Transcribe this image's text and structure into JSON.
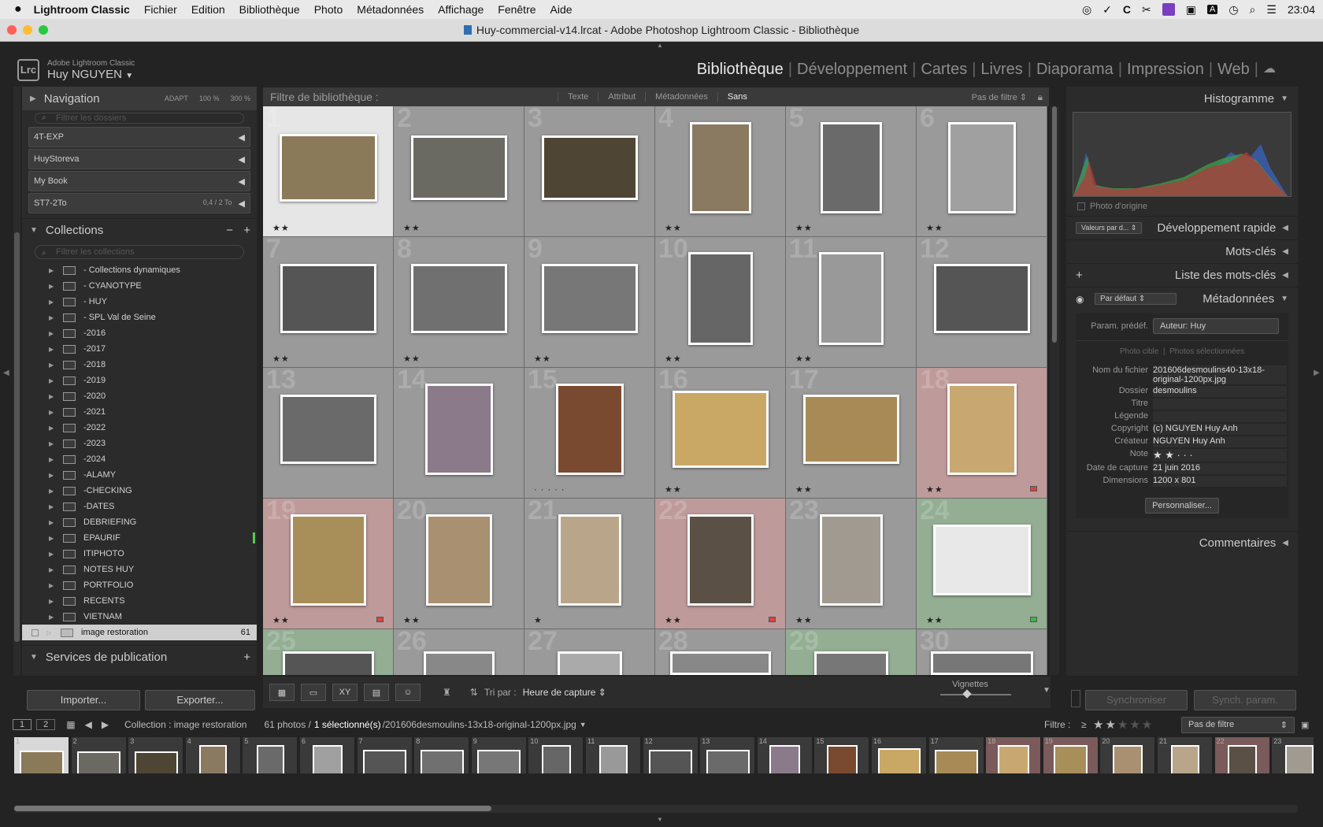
{
  "menubar": {
    "app_name": "Lightroom Classic",
    "items": [
      "Fichier",
      "Edition",
      "Bibliothèque",
      "Photo",
      "Métadonnées",
      "Affichage",
      "Fenêtre",
      "Aide"
    ],
    "clock": "23:04",
    "status_a": "A"
  },
  "window": {
    "title": "Huy-commercial-v14.lrcat - Adobe Photoshop Lightroom Classic - Bibliothèque"
  },
  "identity": {
    "brand": "Adobe Lightroom Classic",
    "user": "Huy NGUYEN",
    "logo": "Lrc"
  },
  "modules": {
    "items": [
      "Bibliothèque",
      "Développement",
      "Cartes",
      "Livres",
      "Diaporama",
      "Impression",
      "Web"
    ],
    "active": "Bibliothèque"
  },
  "left": {
    "navigation": {
      "title": "Navigation",
      "adapt": "ADAPT",
      "z100": "100 %",
      "z300": "300 %"
    },
    "folders_search": "Filtrer les dossiers",
    "volumes": [
      {
        "name": "4T-EXP",
        "info": ""
      },
      {
        "name": "HuyStoreva",
        "info": ""
      },
      {
        "name": "My Book",
        "info": ""
      },
      {
        "name": "ST7-2To",
        "info": "0,4 / 2 To"
      }
    ],
    "collections": {
      "title": "Collections",
      "search": "Filtrer les collections",
      "items": [
        "- Collections dynamiques",
        "- CYANOTYPE",
        "- HUY",
        "- SPL Val de Seine",
        "-2016",
        "-2017",
        "-2018",
        "-2019",
        "-2020",
        "-2021",
        "-2022",
        "-2023",
        "-2024",
        "-ALAMY",
        "-CHECKING",
        "-DATES",
        "DEBRIEFING",
        "EPAURIF",
        "ITIPHOTO",
        "NOTES HUY",
        "PORTFOLIO",
        "RECENTS",
        "VIETNAM"
      ],
      "selected": "image restoration",
      "selected_count": "61"
    },
    "publish": {
      "title": "Services de publication"
    },
    "import_button": "Importer...",
    "export_button": "Exporter..."
  },
  "filterbar": {
    "label": "Filtre de bibliothèque :",
    "options": [
      "Texte",
      "Attribut",
      "Métadonnées",
      "Sans"
    ],
    "preset": "Pas de filtre"
  },
  "grid": {
    "cells": [
      {
        "n": "1",
        "stars": "★★",
        "bg": "#e6e6e6",
        "tw": 124,
        "th": 86,
        "tc": "#8a7a5a"
      },
      {
        "n": "2",
        "stars": "★★",
        "bg": "#9a9a9a",
        "tw": 122,
        "th": 82,
        "tc": "#6a6a62"
      },
      {
        "n": "3",
        "stars": "",
        "bg": "#9a9a9a",
        "tw": 122,
        "th": 82,
        "tc": "#4e4535"
      },
      {
        "n": "4",
        "stars": "★★",
        "bg": "#9a9a9a",
        "tw": 78,
        "th": 116,
        "tc": "#8a7a62"
      },
      {
        "n": "5",
        "stars": "★★",
        "bg": "#9a9a9a",
        "tw": 78,
        "th": 116,
        "tc": "#6a6a6a"
      },
      {
        "n": "6",
        "stars": "★★",
        "bg": "#9a9a9a",
        "tw": 86,
        "th": 116,
        "tc": "#a0a0a0"
      },
      {
        "n": "7",
        "stars": "★★",
        "bg": "#9a9a9a",
        "tw": 122,
        "th": 88,
        "tc": "#555"
      },
      {
        "n": "8",
        "stars": "★★",
        "bg": "#9a9a9a",
        "tw": 122,
        "th": 88,
        "tc": "#707070"
      },
      {
        "n": "9",
        "stars": "★★",
        "bg": "#9a9a9a",
        "tw": 122,
        "th": 88,
        "tc": "#777"
      },
      {
        "n": "10",
        "stars": "★★",
        "bg": "#9a9a9a",
        "tw": 82,
        "th": 118,
        "tc": "#666"
      },
      {
        "n": "11",
        "stars": "★★",
        "bg": "#9a9a9a",
        "tw": 82,
        "th": 118,
        "tc": "#999"
      },
      {
        "n": "12",
        "stars": "",
        "bg": "#9a9a9a",
        "tw": 122,
        "th": 88,
        "tc": "#555"
      },
      {
        "n": "13",
        "stars": "",
        "bg": "#9a9a9a",
        "tw": 122,
        "th": 88,
        "tc": "#6a6a6a"
      },
      {
        "n": "14",
        "stars": "",
        "bg": "#9a9a9a",
        "tw": 86,
        "th": 116,
        "tc": "#8a7a8a"
      },
      {
        "n": "15",
        "stars": "· · · · ·",
        "bg": "#9a9a9a",
        "tw": 86,
        "th": 116,
        "tc": "#7a4a30"
      },
      {
        "n": "16",
        "stars": "★★",
        "bg": "#9a9a9a",
        "tw": 122,
        "th": 98,
        "tc": "#c9a866"
      },
      {
        "n": "17",
        "stars": "★★",
        "bg": "#9a9a9a",
        "tw": 122,
        "th": 88,
        "tc": "#a88a56"
      },
      {
        "n": "18",
        "stars": "★★",
        "bg": "#bf9a9a",
        "tw": 88,
        "th": 116,
        "tc": "#c8a870"
      },
      {
        "n": "19",
        "stars": "★★",
        "bg": "#bf9a9a",
        "tw": 96,
        "th": 116,
        "tc": "#a88e58"
      },
      {
        "n": "20",
        "stars": "★★",
        "bg": "#9a9a9a",
        "tw": 84,
        "th": 116,
        "tc": "#a89070"
      },
      {
        "n": "21",
        "stars": "★",
        "bg": "#9a9a9a",
        "tw": 80,
        "th": 116,
        "tc": "#b9a68a"
      },
      {
        "n": "22",
        "stars": "★★",
        "bg": "#bf9a9a",
        "tw": 84,
        "th": 116,
        "tc": "#5a5045"
      },
      {
        "n": "23",
        "stars": "★★",
        "bg": "#9a9a9a",
        "tw": 80,
        "th": 116,
        "tc": "#a09a90"
      },
      {
        "n": "24",
        "stars": "★★",
        "bg": "#93ae93",
        "tw": 124,
        "th": 90,
        "tc": "#e8e8e8"
      },
      {
        "n": "25",
        "stars": "",
        "bg": "#93ae93",
        "tw": 116,
        "th": 40,
        "tc": "#555"
      },
      {
        "n": "26",
        "stars": "",
        "bg": "#9a9a9a",
        "tw": 90,
        "th": 40,
        "tc": "#888"
      },
      {
        "n": "27",
        "stars": "",
        "bg": "#9a9a9a",
        "tw": 82,
        "th": 40,
        "tc": "#aaa"
      },
      {
        "n": "28",
        "stars": "",
        "bg": "#9a9a9a",
        "tw": 128,
        "th": 30,
        "tc": "#888"
      },
      {
        "n": "29",
        "stars": "",
        "bg": "#93ae93",
        "tw": 94,
        "th": 40,
        "tc": "#777"
      },
      {
        "n": "30",
        "stars": "",
        "bg": "#9a9a9a",
        "tw": 130,
        "th": 30,
        "tc": "#777"
      }
    ]
  },
  "toolbar": {
    "sort_label": "Tri par :",
    "sort_value": "Heure de capture",
    "thumbs_label": "Vignettes"
  },
  "right": {
    "histogram": {
      "title": "Histogramme",
      "original": "Photo d'origine"
    },
    "quick_dev": {
      "title": "Développement rapide",
      "preset": "Valeurs par d..."
    },
    "keywords": {
      "title": "Mots-clés"
    },
    "keyword_list": {
      "title": "Liste des mots-clés"
    },
    "metadata": {
      "title": "Métadonnées",
      "preset_select": "Par défaut",
      "preset_label": "Param. prédéf.",
      "preset_value": "Auteur: Huy",
      "target_photo": "Photo cible",
      "selected_photos": "Photos sélectionnées",
      "rows": [
        {
          "k": "Nom du fichier",
          "v": "201606desmoulins40-13x18-original-1200px.jpg"
        },
        {
          "k": "Dossier",
          "v": "desmoulins"
        },
        {
          "k": "Titre",
          "v": ""
        },
        {
          "k": "Légende",
          "v": ""
        },
        {
          "k": "Copyright",
          "v": "(c) NGUYEN Huy Anh"
        },
        {
          "k": "Créateur",
          "v": "NGUYEN Huy Anh"
        },
        {
          "k": "Note",
          "v": "★ ★ · · ·"
        },
        {
          "k": "Date de capture",
          "v": "21 juin 2016"
        },
        {
          "k": "Dimensions",
          "v": "1200 x 801"
        }
      ],
      "customize": "Personnaliser..."
    },
    "comments": {
      "title": "Commentaires"
    },
    "sync_button": "Synchroniser",
    "sync_settings_button": "Synch. param."
  },
  "filmstrip": {
    "page1": "1",
    "page2": "2",
    "source": "Collection : image restoration",
    "count": "61 photos /",
    "selected": "1 sélectionné(s)",
    "file": "/201606desmoulins-13x18-original-1200px.jpg",
    "filter_label": "Filtre :",
    "filter_op": "≥",
    "filter_stars": "★★",
    "filter_empty_stars": "★★★",
    "filter_value": "Pas de filtre"
  },
  "colors": {
    "accent": "#e8e8e8",
    "red_label": "#d84444",
    "green_label": "#44b344",
    "active_module": "#e8e8e8"
  }
}
